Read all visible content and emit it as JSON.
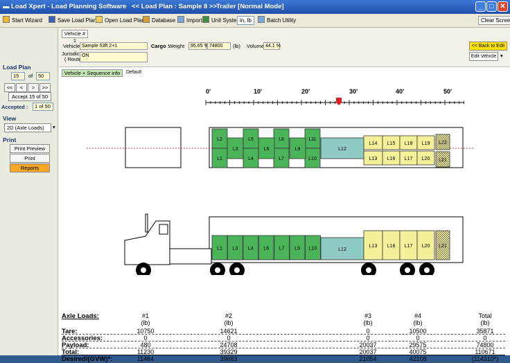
{
  "window": {
    "app_title": "Load Xpert - Load Planning Software",
    "plan_title": "<< Load Plan : Sample 8 >>",
    "mode_title": "Trailer  [Normal Mode]"
  },
  "toolbar": {
    "start_wizard": "Start Wizard",
    "save": "Save Load Plan",
    "open": "Open Load Plan",
    "database": "Database",
    "import": "Import",
    "unit_system_label": "Unit System",
    "unit_system_value": "in, lb",
    "batch": "Batch Utility",
    "clear": "Clear Screen"
  },
  "left": {
    "load_plan": "Load Plan",
    "current": "15",
    "of": "of",
    "total": "50",
    "nav": [
      "<<",
      "<",
      ">",
      ">>"
    ],
    "accept_btn": "Accept 15 of 50",
    "accepted_label": "Accepted :",
    "accepted_value": "1 of 50",
    "view": "View",
    "view_value": "2D (Axle Loads)",
    "print": "Print",
    "print_preview": "Print Preview",
    "print_btn": "Print",
    "reports": "Reports"
  },
  "vehicle": {
    "tab": "Vehicle # 1",
    "vehicle_label": "Vehicle",
    "vehicle_value": "Sample 53ft 2+1",
    "jurisdiction_label": "Jurisdiction",
    "routes_label": "( Routes )",
    "jurisdiction_value": "ON",
    "cargo_label": "Cargo :",
    "weight_label": "Weight",
    "weight_pct": "95.65 %",
    "weight_value": "74800",
    "weight_unit": "(lb)",
    "volume_label": "Volume",
    "volume_value": "44.1 %",
    "back_btn": "<< Back to Edit",
    "edit_btn": "Edit Vehicle"
  },
  "view_tabs": [
    "Vehicle + Sequence info",
    "Default"
  ],
  "ruler": [
    "0'",
    "10'",
    "20'",
    "30'",
    "40'",
    "50'"
  ],
  "top_boxes": {
    "green_upper": [
      "L2",
      "L5",
      "L8",
      "L11"
    ],
    "green_mid": [
      "L3",
      "L6",
      "L9"
    ],
    "green_lower": [
      "L1",
      "L4",
      "L7",
      "L10"
    ],
    "teal": "L12",
    "yellow_upper": [
      "L14",
      "L15",
      "L18",
      "L19"
    ],
    "yellow_lower": [
      "L13",
      "L16",
      "L17",
      "L20"
    ],
    "hatched": [
      "L22",
      "L21"
    ]
  },
  "side_boxes": {
    "green": [
      "L1",
      "L3",
      "L4",
      "L6",
      "L7",
      "L9",
      "L10"
    ],
    "teal": "L12",
    "yellow": [
      "L13",
      "L16",
      "L17",
      "L20"
    ],
    "hatched": "L21"
  },
  "axle_table": {
    "title": "Axle Loads:",
    "headers": [
      "#1",
      "#2",
      "#3",
      "#4",
      "Total"
    ],
    "units": [
      "(lb)",
      "(lb)",
      "(lb)",
      "(lb)",
      "(lb)"
    ],
    "rows": [
      {
        "label": "Tare:",
        "values": [
          "10750",
          "14621",
          "0",
          "10500",
          "35871"
        ]
      },
      {
        "label": "Accessories:",
        "values": [
          "0",
          "0",
          "0",
          "0",
          "0"
        ]
      },
      {
        "label": "Payload:",
        "values": [
          "480",
          "24708",
          "20037",
          "29575",
          "74800"
        ]
      },
      {
        "label": "Total:",
        "values": [
          "11230",
          "39329",
          "20037",
          "40075",
          "110671"
        ]
      },
      {
        "label": "Desired/(GVW)*:",
        "values": [
          "11464",
          "39683",
          "21054",
          "42108",
          "(114310*)"
        ]
      }
    ]
  },
  "colors": {
    "green": "#4bb45a",
    "teal": "#8fcac4",
    "yellow": "#f4f09a",
    "accent": "#ffe300"
  }
}
